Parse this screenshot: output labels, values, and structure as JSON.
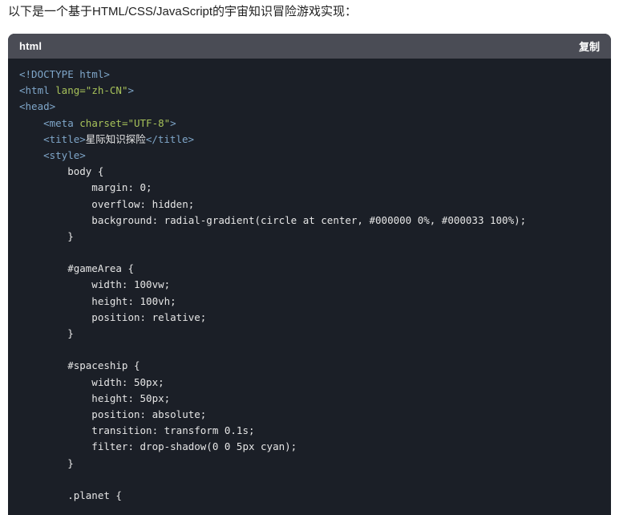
{
  "intro": "以下是一个基于HTML/CSS/JavaScript的宇宙知识冒险游戏实现：",
  "code_block": {
    "language": "html",
    "copy_label": "复制",
    "lines": [
      [
        {
          "t": "<!DOCTYPE html>",
          "c": "tag"
        }
      ],
      [
        {
          "t": "<html ",
          "c": "tag"
        },
        {
          "t": "lang=",
          "c": "attr"
        },
        {
          "t": "\"zh-CN\"",
          "c": "str"
        },
        {
          "t": ">",
          "c": "tag"
        }
      ],
      [
        {
          "t": "<head>",
          "c": "tag"
        }
      ],
      [
        {
          "t": "    ",
          "c": "txt"
        },
        {
          "t": "<meta ",
          "c": "tag"
        },
        {
          "t": "charset=",
          "c": "attr"
        },
        {
          "t": "\"UTF-8\"",
          "c": "str"
        },
        {
          "t": ">",
          "c": "tag"
        }
      ],
      [
        {
          "t": "    ",
          "c": "txt"
        },
        {
          "t": "<title>",
          "c": "tag"
        },
        {
          "t": "星际知识探险",
          "c": "txt"
        },
        {
          "t": "</title>",
          "c": "tag"
        }
      ],
      [
        {
          "t": "    ",
          "c": "txt"
        },
        {
          "t": "<style>",
          "c": "tag"
        }
      ],
      [
        {
          "t": "        body {",
          "c": "txt"
        }
      ],
      [
        {
          "t": "            margin: 0;",
          "c": "txt"
        }
      ],
      [
        {
          "t": "            overflow: hidden;",
          "c": "txt"
        }
      ],
      [
        {
          "t": "            background: radial-gradient(circle at center, #000000 0%, #000033 100%);",
          "c": "txt"
        }
      ],
      [
        {
          "t": "        }",
          "c": "txt"
        }
      ],
      [
        {
          "t": "",
          "c": "txt"
        }
      ],
      [
        {
          "t": "        #gameArea {",
          "c": "txt"
        }
      ],
      [
        {
          "t": "            width: 100vw;",
          "c": "txt"
        }
      ],
      [
        {
          "t": "            height: 100vh;",
          "c": "txt"
        }
      ],
      [
        {
          "t": "            position: relative;",
          "c": "txt"
        }
      ],
      [
        {
          "t": "        }",
          "c": "txt"
        }
      ],
      [
        {
          "t": "",
          "c": "txt"
        }
      ],
      [
        {
          "t": "        #spaceship {",
          "c": "txt"
        }
      ],
      [
        {
          "t": "            width: 50px;",
          "c": "txt"
        }
      ],
      [
        {
          "t": "            height: 50px;",
          "c": "txt"
        }
      ],
      [
        {
          "t": "            position: absolute;",
          "c": "txt"
        }
      ],
      [
        {
          "t": "            transition: transform 0.1s;",
          "c": "txt"
        }
      ],
      [
        {
          "t": "            filter: drop-shadow(0 0 5px cyan);",
          "c": "txt"
        }
      ],
      [
        {
          "t": "        }",
          "c": "txt"
        }
      ],
      [
        {
          "t": "",
          "c": "txt"
        }
      ],
      [
        {
          "t": "        .planet {",
          "c": "txt"
        }
      ]
    ]
  }
}
